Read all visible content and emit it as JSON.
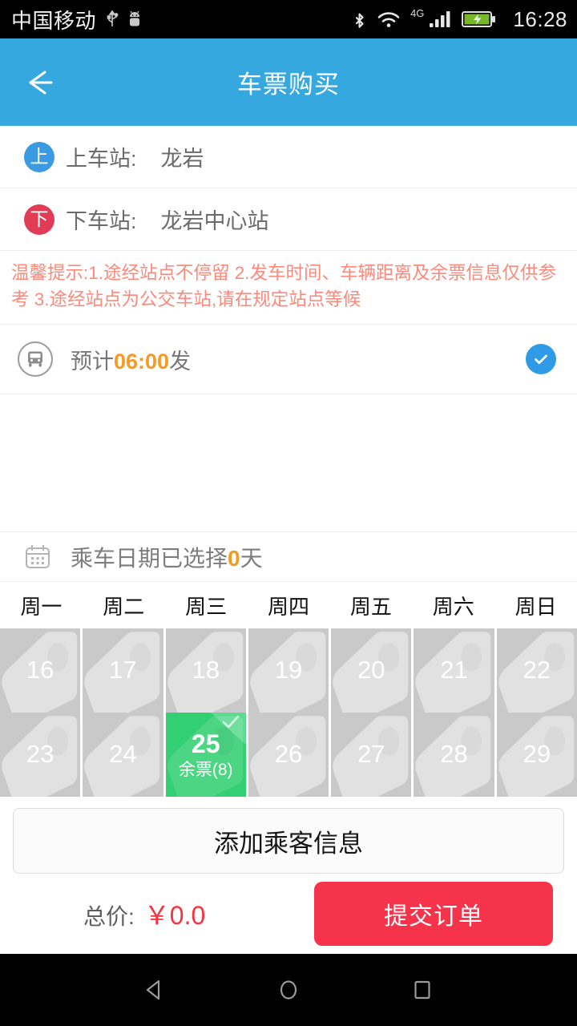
{
  "statusbar": {
    "carrier": "中国移动",
    "time": "16:28",
    "network_label": "4G",
    "icons": [
      "usb-icon",
      "android-robot-icon",
      "bluetooth-icon",
      "wifi-icon",
      "signal-bars-icon",
      "battery-charging-icon"
    ]
  },
  "header": {
    "title": "车票购买",
    "back_icon": "arrow-left-icon"
  },
  "stations": {
    "boarding": {
      "badge": "上",
      "label": "上车站:",
      "value": "龙岩"
    },
    "arrival": {
      "badge": "下",
      "label": "下车站:",
      "value": "龙岩中心站"
    }
  },
  "notice": {
    "text": "温馨提示:1.途经站点不停留 2.发车时间、车辆距离及余票信息仅供参考 3.途经站点为公交车站,请在规定站点等候",
    "color": "#fb8a7c"
  },
  "departure": {
    "prefix": "预计",
    "time": "06:00",
    "suffix": "发",
    "bus_icon": "bus-icon",
    "selected_icon": "check-circle-icon",
    "selected": true,
    "accent_color": "#f59a23"
  },
  "date_section": {
    "calendar_icon": "calendar-icon",
    "label_prefix": "乘车日期已选择",
    "selected_count": "0",
    "label_suffix": "天",
    "weekdays": [
      "周一",
      "周二",
      "周三",
      "周四",
      "周五",
      "周六",
      "周日"
    ],
    "rows": [
      [
        {
          "day": "16",
          "sub": "",
          "selected": false
        },
        {
          "day": "17",
          "sub": "",
          "selected": false
        },
        {
          "day": "18",
          "sub": "",
          "selected": false
        },
        {
          "day": "19",
          "sub": "",
          "selected": false
        },
        {
          "day": "20",
          "sub": "",
          "selected": false
        },
        {
          "day": "21",
          "sub": "",
          "selected": false
        },
        {
          "day": "22",
          "sub": "",
          "selected": false
        }
      ],
      [
        {
          "day": "23",
          "sub": "",
          "selected": false
        },
        {
          "day": "24",
          "sub": "",
          "selected": false
        },
        {
          "day": "25",
          "sub": "余票(8)",
          "selected": true
        },
        {
          "day": "26",
          "sub": "",
          "selected": false
        },
        {
          "day": "27",
          "sub": "",
          "selected": false
        },
        {
          "day": "28",
          "sub": "",
          "selected": false
        },
        {
          "day": "29",
          "sub": "",
          "selected": false
        }
      ]
    ],
    "selected_color": "#32d072",
    "disabled_color": "#c9c9c9"
  },
  "actions": {
    "add_passenger": "添加乘客信息",
    "total_label": "总价:",
    "total_value": "￥0.0",
    "submit": "提交订单",
    "submit_color": "#f5334a",
    "price_color": "#f5333f"
  },
  "navbar": {
    "back": "nav-back-triangle-icon",
    "home": "nav-home-circle-icon",
    "recents": "nav-recents-square-icon"
  }
}
